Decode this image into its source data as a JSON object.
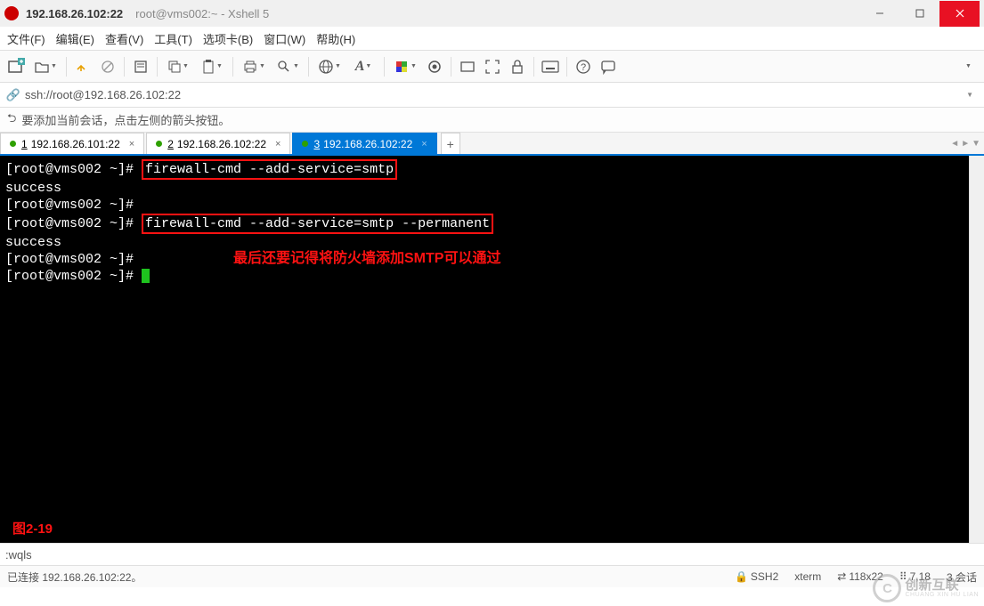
{
  "title": {
    "bold": "192.168.26.102:22",
    "normal": "root@vms002:~ - Xshell 5"
  },
  "menu": [
    "文件(F)",
    "编辑(E)",
    "查看(V)",
    "工具(T)",
    "选项卡(B)",
    "窗口(W)",
    "帮助(H)"
  ],
  "address": "ssh://root@192.168.26.102:22",
  "info_hint": "要添加当前会话，点击左侧的箭头按钮。",
  "tabs": [
    {
      "num": "1",
      "label": "192.168.26.101:22",
      "active": false
    },
    {
      "num": "2",
      "label": "192.168.26.102:22",
      "active": false
    },
    {
      "num": "3",
      "label": "192.168.26.102:22",
      "active": true
    }
  ],
  "terminal": {
    "prompt": "[root@vms002 ~]# ",
    "cmd1": "firewall-cmd --add-service=smtp",
    "resp1": "success",
    "cmd2": "firewall-cmd --add-service=smtp --permanent",
    "resp2": "success",
    "annotation": "最后还要记得将防火墙添加SMTP可以通过",
    "figure_label": "图2-19"
  },
  "cmd_row": ":wqls",
  "statusbar": {
    "left": "已连接 192.168.26.102:22。",
    "ssh": "SSH2",
    "term": "xterm",
    "size": "118x22",
    "pos": "7,18",
    "sessions": "3 会话"
  },
  "watermark": {
    "big": "创新互联",
    "sub": "CHUANG XIN HU LIAN"
  }
}
